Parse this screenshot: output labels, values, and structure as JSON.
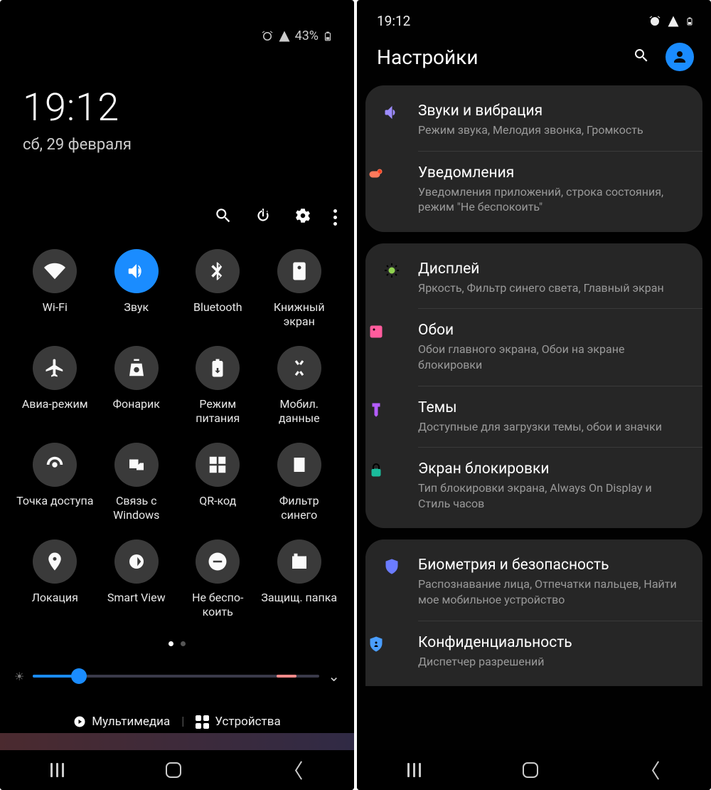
{
  "left": {
    "status": {
      "battery_pct": "43%"
    },
    "clock": {
      "time": "19:12",
      "date": "сб, 29 февраля"
    },
    "tiles": [
      {
        "label": "Wi-Fi",
        "active": false
      },
      {
        "label": "Звук",
        "active": true
      },
      {
        "label": "Bluetooth",
        "active": false
      },
      {
        "label": "Книжный экран",
        "active": false
      },
      {
        "label": "Авиа-режим",
        "active": false
      },
      {
        "label": "Фонарик",
        "active": false
      },
      {
        "label": "Режим питания",
        "active": false
      },
      {
        "label": "Мобил. данные",
        "active": false
      },
      {
        "label": "Точка доступа",
        "active": false
      },
      {
        "label": "Связь с Windows",
        "active": false
      },
      {
        "label": "QR-код",
        "active": false
      },
      {
        "label": "Фильтр синего",
        "active": false
      },
      {
        "label": "Локация",
        "active": false
      },
      {
        "label": "Smart View",
        "active": false
      },
      {
        "label": "Не беспо-коить",
        "active": false
      },
      {
        "label": "Защищ. папка",
        "active": false
      }
    ],
    "bottom": {
      "media": "Мультимедиа",
      "devices": "Устройства"
    }
  },
  "right": {
    "status": {
      "time": "19:12"
    },
    "header": "Настройки",
    "groups": [
      [
        {
          "title": "Звуки и вибрация",
          "sub": "Режим звука, Мелодия звонка, Громкость",
          "color": "#9d8cff"
        },
        {
          "title": "Уведомления",
          "sub": "Уведомления приложений, строка состояния, режим \"Не беспокоить\"",
          "color": "#ff7a5c"
        }
      ],
      [
        {
          "title": "Дисплей",
          "sub": "Яркость, Фильтр синего света, Главный экран",
          "color": "#8fd14f"
        },
        {
          "title": "Обои",
          "sub": "Обои главного экрана, Обои на экране блокировки",
          "color": "#ff5c9d"
        },
        {
          "title": "Темы",
          "sub": "Доступные для загрузки темы, обои и значки",
          "color": "#b45cff"
        },
        {
          "title": "Экран блокировки",
          "sub": "Тип блокировки экрана, Always On Display и Стиль часов",
          "color": "#1abc9c"
        }
      ],
      [
        {
          "title": "Биометрия и безопасность",
          "sub": "Распознавание лица, Отпечатки пальцев, Найти мое мобильное устройство",
          "color": "#6b7cff"
        },
        {
          "title": "Конфиденциальность",
          "sub": "Диспетчер разрешений",
          "color": "#4a9eff"
        }
      ]
    ]
  }
}
